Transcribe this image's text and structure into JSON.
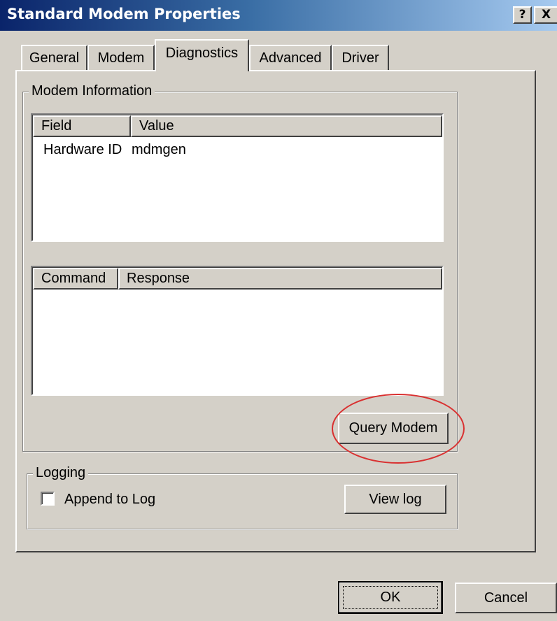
{
  "window": {
    "title": "Standard Modem Properties",
    "help_glyph": "?",
    "close_glyph": "X"
  },
  "tabs": [
    {
      "label": "General",
      "active": false
    },
    {
      "label": "Modem",
      "active": false
    },
    {
      "label": "Diagnostics",
      "active": true
    },
    {
      "label": "Advanced",
      "active": false
    },
    {
      "label": "Driver",
      "active": false
    }
  ],
  "modem_info": {
    "group_label": "Modem Information",
    "info_list": {
      "headers": [
        "Field",
        "Value"
      ],
      "rows": [
        {
          "field": "Hardware ID",
          "value": "mdmgen"
        }
      ]
    },
    "command_list": {
      "headers": [
        "Command",
        "Response"
      ],
      "rows": []
    },
    "query_button": "Query Modem"
  },
  "logging": {
    "group_label": "Logging",
    "append_label": "Append to Log",
    "append_checked": false,
    "view_log_button": "View log"
  },
  "footer": {
    "ok_button": "OK",
    "cancel_button": "Cancel"
  },
  "colors": {
    "face": "#d4d0c8",
    "title_start": "#0a246a",
    "title_end": "#a6caf0",
    "annotation": "#d93030"
  }
}
